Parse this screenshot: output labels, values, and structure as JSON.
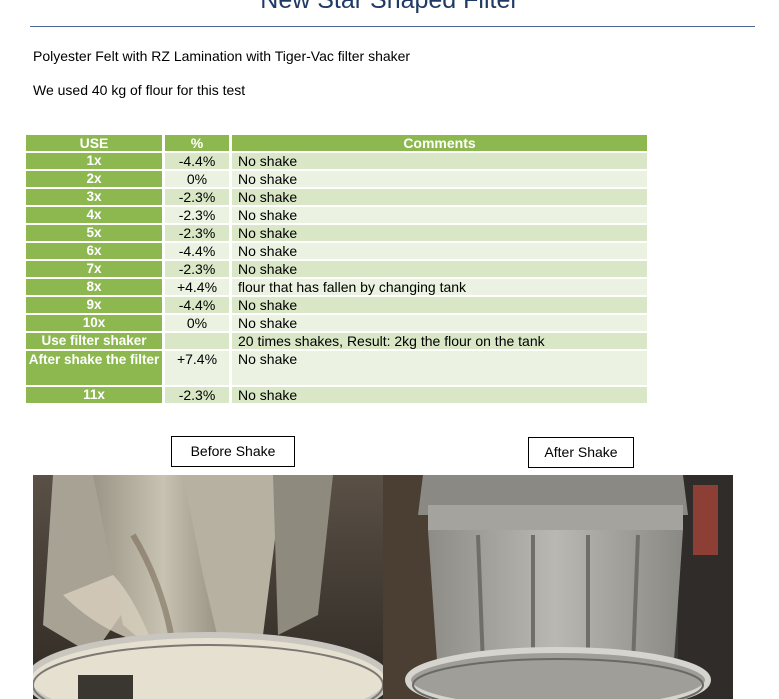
{
  "title": "New Star Shaped Filter",
  "intro": {
    "line1": "Polyester Felt with RZ Lamination with Tiger-Vac filter shaker",
    "line2": "We used 40 kg of flour for this test"
  },
  "table": {
    "headers": [
      "USE",
      "%",
      "Comments"
    ],
    "rows": [
      {
        "use": "1x",
        "pct": "-4.4%",
        "comment": "No shake"
      },
      {
        "use": "2x",
        "pct": "0%",
        "comment": "No shake"
      },
      {
        "use": "3x",
        "pct": "-2.3%",
        "comment": "No shake"
      },
      {
        "use": "4x",
        "pct": "-2.3%",
        "comment": "No shake"
      },
      {
        "use": "5x",
        "pct": "-2.3%",
        "comment": "No shake"
      },
      {
        "use": "6x",
        "pct": "-4.4%",
        "comment": "No shake"
      },
      {
        "use": "7x",
        "pct": "-2.3%",
        "comment": "No shake"
      },
      {
        "use": "8x",
        "pct": "+4.4%",
        "comment": "flour that has fallen by changing tank"
      },
      {
        "use": "9x",
        "pct": "-4.4%",
        "comment": "No shake"
      },
      {
        "use": "10x",
        "pct": "0%",
        "comment": "No shake"
      },
      {
        "use": "Use filter shaker",
        "pct": "",
        "comment": "20 times shakes, Result: 2kg the flour on the tank"
      },
      {
        "use": "After shake the filter",
        "pct": "+7.4%",
        "comment": "No shake"
      },
      {
        "use": "11x",
        "pct": "-2.3%",
        "comment": "No shake"
      }
    ]
  },
  "labels": {
    "before": "Before Shake",
    "after": "After Shake"
  }
}
